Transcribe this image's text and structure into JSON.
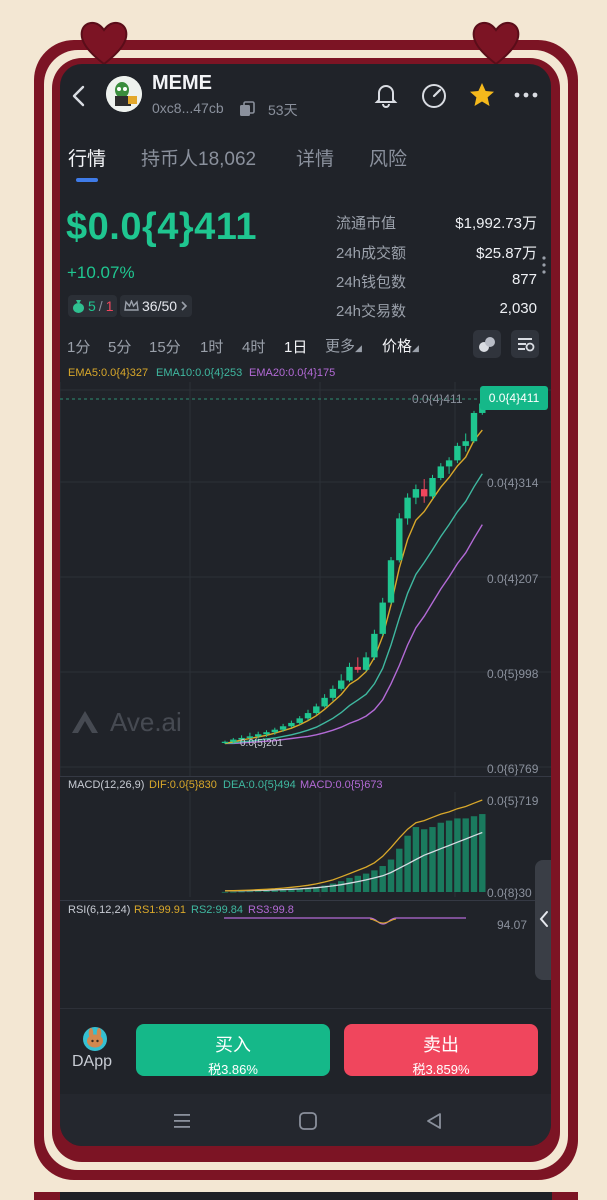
{
  "header": {
    "token_name": "MEME",
    "address": "0xc8...47cb",
    "age": "53天"
  },
  "tabs": [
    {
      "label": "行情",
      "active": true
    },
    {
      "label": "持币人18,062",
      "active": false
    },
    {
      "label": "详情",
      "active": false
    },
    {
      "label": "风险",
      "active": false
    }
  ],
  "price": {
    "value": "$0.0{4}411",
    "change": "+10.07%",
    "badge1_a": "5",
    "badge1_b": "1",
    "badge2": "36/50"
  },
  "stats": [
    {
      "label": "流通市值",
      "value": "$1,992.73万"
    },
    {
      "label": "24h成交额",
      "value": "$25.87万"
    },
    {
      "label": "24h钱包数",
      "value": "877"
    },
    {
      "label": "24h交易数",
      "value": "2,030"
    }
  ],
  "intervals": [
    "1分",
    "5分",
    "15分",
    "1时",
    "4时",
    "1日",
    "更多",
    "价格"
  ],
  "active_interval": "1日",
  "ema": {
    "ema5": "EMA5:0.0{4}327",
    "ema10": "EMA10:0.0{4}253",
    "ema20": "EMA20:0.0{4}175"
  },
  "price_axis": [
    "0.0{4}314",
    "0.0{4}207",
    "0.0{5}998",
    "0.0{6}769"
  ],
  "last_price_line": "0.0{4}411",
  "current_price_tag": "0.0{4}411",
  "low_marker": "0.0{5}201",
  "watermark": "Ave.ai",
  "macd": {
    "label": "MACD(12,26,9)",
    "dif": "DIF:0.0{5}830",
    "dea": "DEA:0.0{5}494",
    "macd": "MACD:0.0{5}673",
    "axis_top": "0.0{5}719",
    "axis_bottom": "0.0{8}30"
  },
  "rsi": {
    "label": "RSI(6,12,24)",
    "rs1": "RS1:99.91",
    "rs2": "RS2:99.84",
    "rs3": "RS3:99.8",
    "axis": "94.07"
  },
  "actions": {
    "dapp": "DApp",
    "buy_label": "买入",
    "buy_tax": "税3.86%",
    "sell_label": "卖出",
    "sell_tax": "税3.859%"
  },
  "colors": {
    "up": "#1fc690",
    "down": "#f0465d",
    "ema5": "#d9a82a",
    "ema10": "#3fb8a0",
    "ema20": "#b36ad6",
    "frame": "#7c1424",
    "accent_tab": "#3f7be8"
  },
  "icons": [
    "back-icon",
    "copy-icon",
    "bell-icon",
    "speed-gauge-icon",
    "star-icon",
    "more-icon",
    "indicator-icon",
    "settings-icon",
    "collapse-icon"
  ],
  "chart_data": {
    "type": "candlestick",
    "candles": [
      {
        "o": 2.01,
        "h": 2.05,
        "l": 1.99,
        "c": 2.03
      },
      {
        "o": 2.03,
        "h": 2.1,
        "l": 2.0,
        "c": 2.07
      },
      {
        "o": 2.07,
        "h": 2.15,
        "l": 2.03,
        "c": 2.1
      },
      {
        "o": 2.1,
        "h": 2.2,
        "l": 2.06,
        "c": 2.13
      },
      {
        "o": 2.13,
        "h": 2.22,
        "l": 2.09,
        "c": 2.17
      },
      {
        "o": 2.17,
        "h": 2.25,
        "l": 2.12,
        "c": 2.21
      },
      {
        "o": 2.21,
        "h": 2.3,
        "l": 2.16,
        "c": 2.26
      },
      {
        "o": 2.26,
        "h": 2.38,
        "l": 2.22,
        "c": 2.33
      },
      {
        "o": 2.33,
        "h": 2.45,
        "l": 2.3,
        "c": 2.4
      },
      {
        "o": 2.4,
        "h": 2.55,
        "l": 2.36,
        "c": 2.5
      },
      {
        "o": 2.5,
        "h": 2.7,
        "l": 2.46,
        "c": 2.62
      },
      {
        "o": 2.62,
        "h": 2.85,
        "l": 2.58,
        "c": 2.78
      },
      {
        "o": 2.78,
        "h": 3.1,
        "l": 2.75,
        "c": 3.0
      },
      {
        "o": 3.0,
        "h": 3.35,
        "l": 2.92,
        "c": 3.25
      },
      {
        "o": 3.25,
        "h": 3.7,
        "l": 3.2,
        "c": 3.5
      },
      {
        "o": 3.5,
        "h": 4.1,
        "l": 3.45,
        "c": 3.95
      },
      {
        "o": 3.95,
        "h": 4.3,
        "l": 3.75,
        "c": 3.85
      },
      {
        "o": 3.85,
        "h": 4.5,
        "l": 3.8,
        "c": 4.3
      },
      {
        "o": 4.3,
        "h": 5.5,
        "l": 4.2,
        "c": 5.3
      },
      {
        "o": 5.3,
        "h": 7.3,
        "l": 5.2,
        "c": 7.0
      },
      {
        "o": 7.0,
        "h": 10.5,
        "l": 6.9,
        "c": 10.2
      },
      {
        "o": 10.2,
        "h": 15.5,
        "l": 10.0,
        "c": 14.8
      },
      {
        "o": 14.8,
        "h": 18.5,
        "l": 14.0,
        "c": 17.8
      },
      {
        "o": 17.8,
        "h": 20.0,
        "l": 16.8,
        "c": 19.2
      },
      {
        "o": 19.2,
        "h": 21.0,
        "l": 17.0,
        "c": 18.0
      },
      {
        "o": 18.0,
        "h": 21.8,
        "l": 17.6,
        "c": 21.2
      },
      {
        "o": 21.2,
        "h": 24.2,
        "l": 20.8,
        "c": 23.5
      },
      {
        "o": 23.5,
        "h": 25.5,
        "l": 22.0,
        "c": 24.8
      },
      {
        "o": 24.8,
        "h": 29.0,
        "l": 24.2,
        "c": 28.2
      },
      {
        "o": 28.2,
        "h": 31.5,
        "l": 26.8,
        "c": 29.4
      },
      {
        "o": 29.4,
        "h": 38.5,
        "l": 29.0,
        "c": 37.8
      },
      {
        "o": 37.8,
        "h": 42.8,
        "l": 37.2,
        "c": 41.1
      }
    ],
    "unit": "1e-6",
    "ema5": [
      2.0,
      2.03,
      2.06,
      2.09,
      2.12,
      2.15,
      2.19,
      2.24,
      2.29,
      2.36,
      2.45,
      2.56,
      2.71,
      2.89,
      3.09,
      3.38,
      3.54,
      3.79,
      4.29,
      5.19,
      6.86,
      9.51,
      12.27,
      14.58,
      15.72,
      17.55,
      19.53,
      21.29,
      23.59,
      25.53,
      29.62,
      32.45
    ],
    "ema10": [
      2.0,
      2.01,
      2.03,
      2.04,
      2.06,
      2.08,
      2.1,
      2.13,
      2.16,
      2.2,
      2.25,
      2.31,
      2.4,
      2.5,
      2.63,
      2.8,
      2.94,
      3.1,
      3.4,
      3.9,
      4.8,
      6.1,
      7.6,
      9.0,
      10.0,
      11.2,
      12.6,
      14.0,
      15.7,
      17.2,
      19.6,
      22.0
    ],
    "ema20": [
      2.0,
      2.0,
      2.01,
      2.02,
      2.03,
      2.04,
      2.05,
      2.07,
      2.09,
      2.11,
      2.13,
      2.16,
      2.2,
      2.25,
      2.31,
      2.39,
      2.46,
      2.55,
      2.7,
      2.95,
      3.4,
      4.0,
      4.8,
      5.6,
      6.2,
      7.0,
      7.9,
      8.8,
      9.9,
      10.9,
      12.4,
      14.0
    ],
    "macd_hist": [
      0.001,
      0.002,
      0.004,
      0.006,
      0.008,
      0.01,
      0.013,
      0.017,
      0.022,
      0.028,
      0.036,
      0.046,
      0.06,
      0.078,
      0.1,
      0.13,
      0.15,
      0.17,
      0.2,
      0.24,
      0.3,
      0.4,
      0.52,
      0.6,
      0.58,
      0.6,
      0.64,
      0.66,
      0.68,
      0.68,
      0.7,
      0.72
    ],
    "macd_dif": [
      0.01,
      0.012,
      0.015,
      0.018,
      0.021,
      0.025,
      0.03,
      0.036,
      0.043,
      0.052,
      0.062,
      0.075,
      0.092,
      0.112,
      0.14,
      0.17,
      0.2,
      0.23,
      0.27,
      0.33,
      0.41,
      0.5,
      0.58,
      0.64,
      0.66,
      0.69,
      0.72,
      0.74,
      0.77,
      0.79,
      0.82,
      0.85
    ],
    "macd_dea": [
      0.01,
      0.011,
      0.012,
      0.013,
      0.015,
      0.017,
      0.019,
      0.022,
      0.025,
      0.029,
      0.034,
      0.04,
      0.047,
      0.056,
      0.067,
      0.081,
      0.096,
      0.112,
      0.13,
      0.15,
      0.18,
      0.22,
      0.26,
      0.3,
      0.34,
      0.37,
      0.4,
      0.43,
      0.46,
      0.49,
      0.52,
      0.55
    ]
  }
}
